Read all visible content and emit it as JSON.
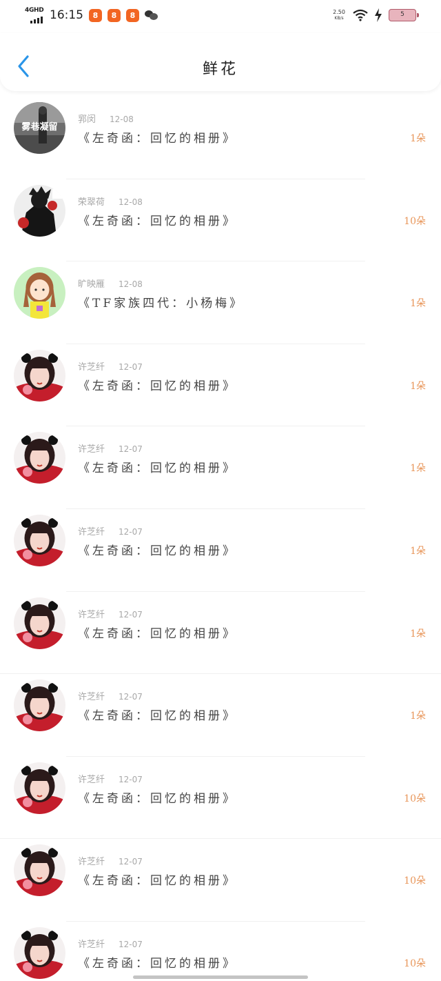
{
  "status_bar": {
    "network": "4GHD",
    "time": "16:15",
    "net_speed_value": "2.50",
    "net_speed_unit": "KB/s",
    "battery_level": "5",
    "app_icon_glyph": "8"
  },
  "header": {
    "title": "鲜花",
    "accent_color": "#2a95e8"
  },
  "records": [
    {
      "user": "郛闵",
      "date": "12-08",
      "work": "《左奇函：回忆的相册》",
      "count": "1朵",
      "avatar": "avatar-photo-street"
    },
    {
      "user": "荣翠荷",
      "date": "12-08",
      "work": "《左奇函：回忆的相册》",
      "count": "10朵",
      "avatar": "avatar-illustration-dark"
    },
    {
      "user": "旷映雁",
      "date": "12-08",
      "work": "《TF家族四代：小杨梅》",
      "count": "1朵",
      "avatar": "avatar-cartoon-girl"
    },
    {
      "user": "许芝纤",
      "date": "12-07",
      "work": "《左奇函：回忆的相册》",
      "count": "1朵",
      "avatar": "avatar-girl-red"
    },
    {
      "user": "许芝纤",
      "date": "12-07",
      "work": "《左奇函：回忆的相册》",
      "count": "1朵",
      "avatar": "avatar-girl-red"
    },
    {
      "user": "许芝纤",
      "date": "12-07",
      "work": "《左奇函：回忆的相册》",
      "count": "1朵",
      "avatar": "avatar-girl-red"
    },
    {
      "user": "许芝纤",
      "date": "12-07",
      "work": "《左奇函：回忆的相册》",
      "count": "1朵",
      "avatar": "avatar-girl-red"
    },
    {
      "user": "许芝纤",
      "date": "12-07",
      "work": "《左奇函：回忆的相册》",
      "count": "1朵",
      "avatar": "avatar-girl-red"
    },
    {
      "user": "许芝纤",
      "date": "12-07",
      "work": "《左奇函：回忆的相册》",
      "count": "10朵",
      "avatar": "avatar-girl-red"
    },
    {
      "user": "许芝纤",
      "date": "12-07",
      "work": "《左奇函：回忆的相册》",
      "count": "10朵",
      "avatar": "avatar-girl-red"
    },
    {
      "user": "许芝纤",
      "date": "12-07",
      "work": "《左奇函：回忆的相册》",
      "count": "10朵",
      "avatar": "avatar-girl-red"
    }
  ],
  "colors": {
    "count": "#e8965a",
    "meta": "#a8a8a8"
  }
}
